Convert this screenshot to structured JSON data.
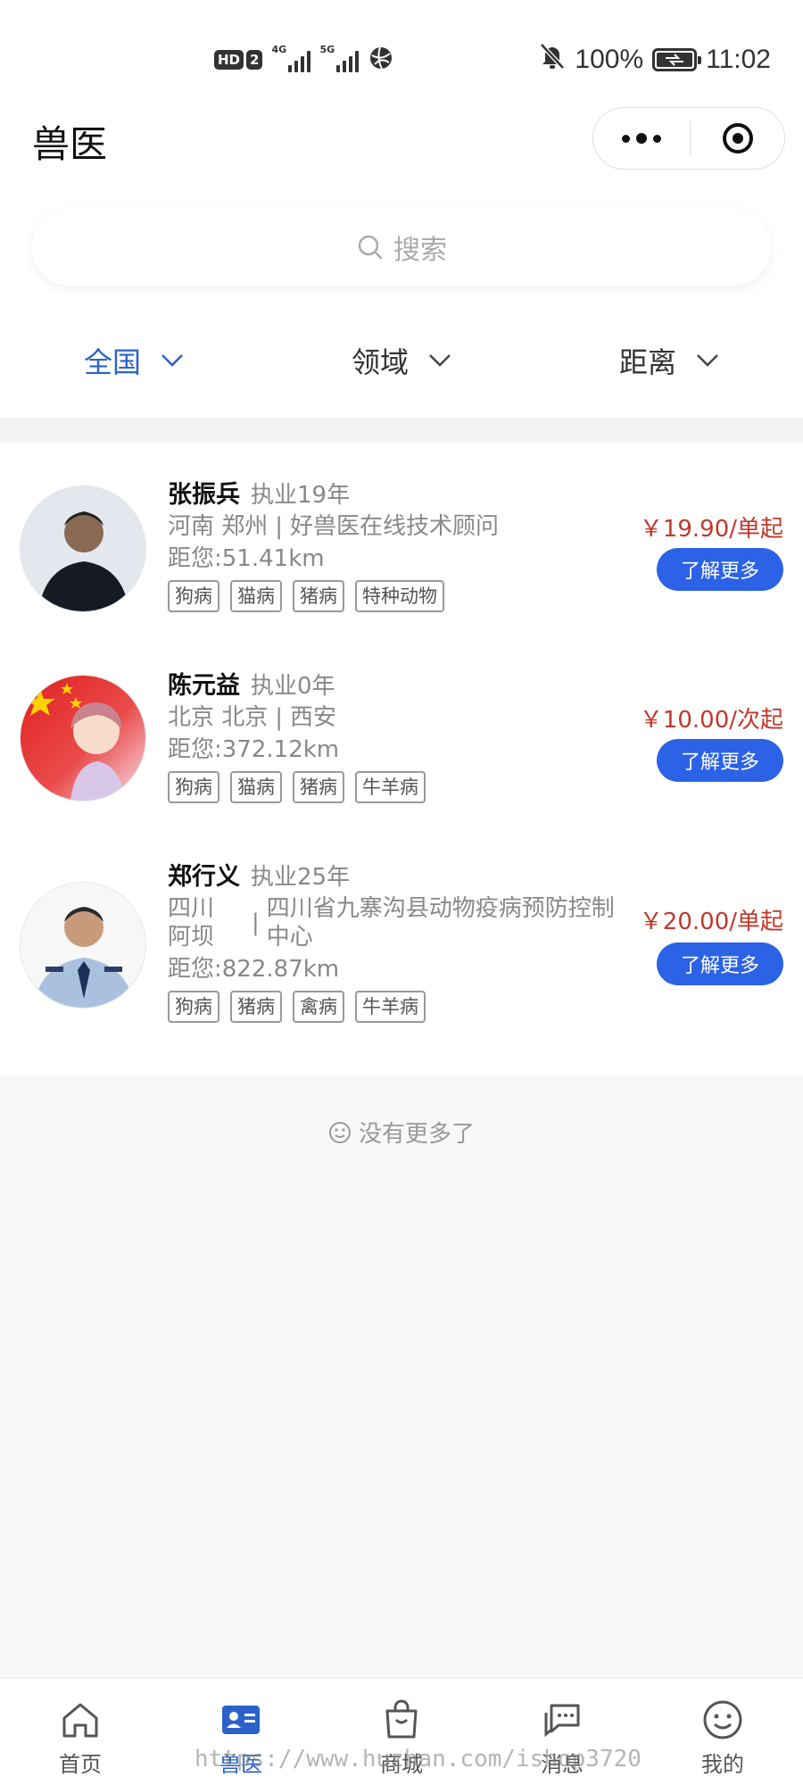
{
  "status_bar": {
    "hd_badge": "HD",
    "sim_badge": "2",
    "signal1_label": "4G",
    "signal2_label": "5G",
    "battery": "100%",
    "time": "11:02"
  },
  "nav": {
    "title": "兽医"
  },
  "search": {
    "placeholder": "搜索"
  },
  "filters": [
    {
      "label": "全国",
      "active": true
    },
    {
      "label": "领域",
      "active": false
    },
    {
      "label": "距离",
      "active": false
    }
  ],
  "vets": [
    {
      "name": "张振兵",
      "experience": "执业19年",
      "location": "河南 郑州",
      "org": "好兽医在线技术顾问",
      "distance": "距您:51.41km",
      "tags": [
        "狗病",
        "猫病",
        "猪病",
        "特种动物"
      ],
      "price": "￥19.90/单起",
      "button": "了解更多"
    },
    {
      "name": "陈元益",
      "experience": "执业0年",
      "location": "北京 北京",
      "org": "西安",
      "distance": "距您:372.12km",
      "tags": [
        "狗病",
        "猫病",
        "猪病",
        "牛羊病"
      ],
      "price": "￥10.00/次起",
      "button": "了解更多"
    },
    {
      "name": "郑行义",
      "experience": "执业25年",
      "location": "四川 阿坝",
      "org": "四川省九寨沟县动物疫病预防控制中心",
      "distance": "距您:822.87km",
      "tags": [
        "狗病",
        "猪病",
        "禽病",
        "牛羊病"
      ],
      "price": "￥20.00/单起",
      "button": "了解更多"
    }
  ],
  "no_more_text": "没有更多了",
  "tab_bar": [
    {
      "label": "首页",
      "icon": "home-icon",
      "active": false
    },
    {
      "label": "兽医",
      "icon": "vet-card-icon",
      "active": true
    },
    {
      "label": "商城",
      "icon": "shopping-bag-icon",
      "active": false
    },
    {
      "label": "消息",
      "icon": "message-icon",
      "active": false
    },
    {
      "label": "我的",
      "icon": "smiley-icon",
      "active": false
    }
  ],
  "watermark": "https://www.huzhan.com/ishop3720",
  "colors": {
    "accent": "#2b62c9",
    "button": "#2b62e6",
    "price": "#c0392b"
  }
}
